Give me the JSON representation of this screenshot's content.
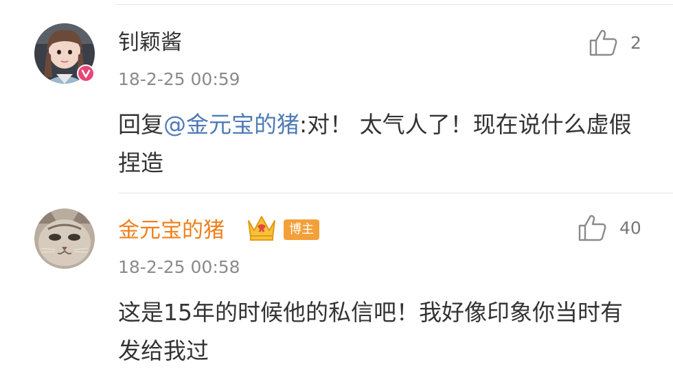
{
  "comments": [
    {
      "username": "钊颖酱",
      "timestamp": "18-2-25 00:59",
      "like_count": "2",
      "reply_prefix": "回复",
      "mention": "@金元宝的猪",
      "text": ":对！ 太气人了！现在说什么虚假捏造",
      "avatar": "avatar-girl",
      "verified_icon": "verified-badge-icon"
    },
    {
      "username": "金元宝的猪",
      "timestamp": "18-2-25 00:58",
      "like_count": "40",
      "badge": "博主",
      "text": "这是15年的时候他的私信吧！我好像印象你当时有发给我过",
      "avatar": "avatar-cat",
      "crown_icon": "crown-icon"
    }
  ],
  "colors": {
    "username": "#333333",
    "blogger_name": "#f07f1c",
    "mention": "#4e7ab6",
    "timestamp": "#8a8a8a",
    "badge_bg": "#f3a03a"
  }
}
